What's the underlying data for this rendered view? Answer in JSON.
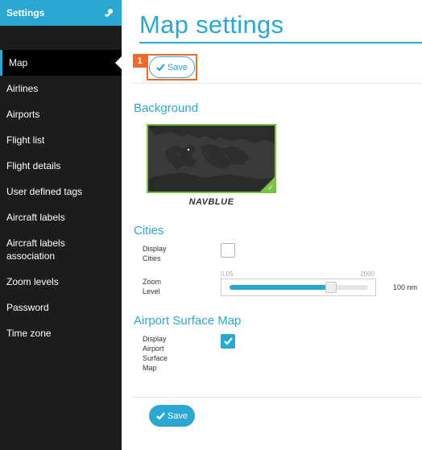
{
  "sidebar": {
    "title": "Settings",
    "items": [
      {
        "label": "Map",
        "active": true
      },
      {
        "label": "Airlines"
      },
      {
        "label": "Airports"
      },
      {
        "label": "Flight list"
      },
      {
        "label": "Flight details"
      },
      {
        "label": "User defined tags"
      },
      {
        "label": "Aircraft labels"
      },
      {
        "label_line1": "Aircraft labels",
        "label_line2": "association"
      },
      {
        "label": "Zoom levels"
      },
      {
        "label": "Password"
      },
      {
        "label": "Time zone"
      }
    ]
  },
  "main": {
    "title": "Map settings",
    "step_badge": "1",
    "save_label_top": "Save",
    "save_label_bottom": "Save",
    "background": {
      "title": "Background",
      "selected_map": "NAVBLUE"
    },
    "cities": {
      "title": "Cities",
      "display_label_line1": "Display",
      "display_label_line2": "Cities",
      "display_checked": false,
      "zoom_label_line1": "Zoom",
      "zoom_label_line2": "Level",
      "zoom_min": "0.05",
      "zoom_max": "2000",
      "zoom_value": "100 nm"
    },
    "airport_surface": {
      "title": "Airport Surface Map",
      "label_line1": "Display",
      "label_line2": "Airport",
      "label_line3": "Surface",
      "label_line4": "Map",
      "checked": true
    }
  },
  "colors": {
    "accent": "#2aa8d2",
    "highlight": "#f06a2e",
    "selected": "#7ac143",
    "sidebar_bg": "#1c1c1c"
  },
  "icons": {
    "pin": "pin-icon",
    "save": "check-icon",
    "checkbox_checked": "check-icon"
  }
}
